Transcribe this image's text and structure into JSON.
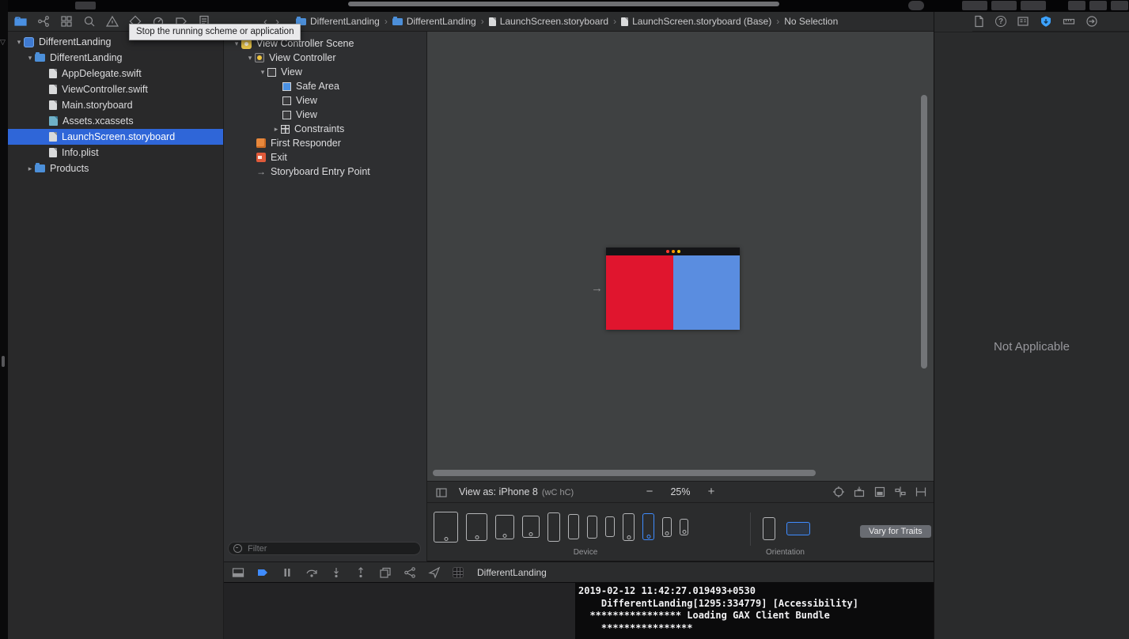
{
  "tooltip": "Stop the running scheme or application",
  "glyphs": {
    "disclosure_open": "▾",
    "disclosure_closed": "▸",
    "crumb_sep": "›",
    "back": "‹",
    "forward": "›",
    "minus": "−",
    "plus": "+",
    "entry_arrow": "→",
    "edge_triangle": "▽",
    "help": "?"
  },
  "colors": {
    "accent_blue": "#3f8cff",
    "selection_blue": "#2f66d8",
    "storyboard_red": "#e0152e",
    "storyboard_blue": "#5a8de0"
  },
  "jump_bar": {
    "crumbs": [
      {
        "label": "DifferentLanding"
      },
      {
        "label": "DifferentLanding"
      },
      {
        "label": "LaunchScreen.storyboard"
      },
      {
        "label": "LaunchScreen.storyboard (Base)"
      },
      {
        "label": "No Selection"
      }
    ]
  },
  "navigator": {
    "rows": [
      {
        "label": "DifferentLanding",
        "type": "project"
      },
      {
        "label": "DifferentLanding",
        "type": "group"
      },
      {
        "label": "AppDelegate.swift",
        "type": "swift-file"
      },
      {
        "label": "ViewController.swift",
        "type": "swift-file"
      },
      {
        "label": "Main.storyboard",
        "type": "storyboard-file"
      },
      {
        "label": "Assets.xcassets",
        "type": "asset-catalog"
      },
      {
        "label": "LaunchScreen.storyboard",
        "type": "storyboard-file",
        "selected": true
      },
      {
        "label": "Info.plist",
        "type": "plist-file"
      },
      {
        "label": "Products",
        "type": "group"
      }
    ]
  },
  "outline": {
    "rows": [
      {
        "label": "View Controller Scene",
        "icon": "scene"
      },
      {
        "label": "View Controller",
        "icon": "view-controller"
      },
      {
        "label": "View",
        "icon": "view"
      },
      {
        "label": "Safe Area",
        "icon": "safe-area"
      },
      {
        "label": "View",
        "icon": "view"
      },
      {
        "label": "View",
        "icon": "view"
      },
      {
        "label": "Constraints",
        "icon": "constraints"
      },
      {
        "label": "First Responder",
        "icon": "first-responder"
      },
      {
        "label": "Exit",
        "icon": "exit"
      },
      {
        "label": "Storyboard Entry Point",
        "icon": "entry-point"
      }
    ],
    "filter_placeholder": "Filter"
  },
  "canvas": {
    "left_color": "#e0152e",
    "right_color": "#5a8de0"
  },
  "view_as_bar": {
    "view_as": "View as: iPhone 8",
    "size_classes": "(wC hC)",
    "zoom": "25%"
  },
  "device_bar": {
    "device_label": "Device",
    "orientation_label": "Orientation",
    "vary_button": "Vary for Traits",
    "devices": [
      "ipad-pro-12-9",
      "ipad-pro-10-5",
      "ipad-9-7",
      "ipad-mini",
      "iphone-xs-max",
      "iphone-xr",
      "iphone-xs",
      "iphone-x",
      "iphone-8-plus",
      "iphone-8-selected",
      "iphone-se",
      "iphone-4s"
    ]
  },
  "debug_bar": {
    "app_name": "DifferentLanding"
  },
  "console": {
    "lines": [
      "2019-02-12 11:42:27.019493+0530",
      "    DifferentLanding[1295:334779] [Accessibility]",
      "  **************** Loading GAX Client Bundle",
      "    ****************"
    ]
  },
  "inspector": {
    "empty_message": "Not Applicable"
  }
}
